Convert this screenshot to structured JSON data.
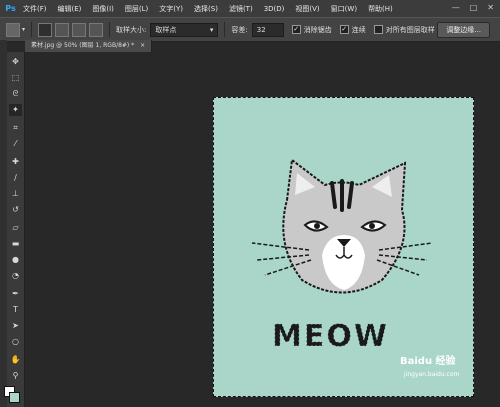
{
  "menubar": {
    "logo": "Ps",
    "items": [
      "文件(F)",
      "编辑(E)",
      "图像(I)",
      "图层(L)",
      "文字(Y)",
      "选择(S)",
      "滤镜(T)",
      "3D(D)",
      "视图(V)",
      "窗口(W)",
      "帮助(H)"
    ],
    "controls": [
      "—",
      "□",
      "✕"
    ]
  },
  "options": {
    "sample_size_label": "取样大小:",
    "sample_size_value": "取样点",
    "tolerance_label": "容差:",
    "tolerance_value": "32",
    "antialias_label": "消除锯齿",
    "contiguous_label": "连续",
    "all_layers_label": "对所有图层取样",
    "refine_edge": "调整边缘..."
  },
  "document": {
    "tab_title": "素材.jpg @ 50% (图层 1, RGB/8#) *",
    "tab_close": "×",
    "artwork_text": "MEOW"
  },
  "watermark": {
    "text": "Baidu 经验",
    "url": "jingyan.baidu.com"
  },
  "tools": [
    "move-icon",
    "marquee-icon",
    "lasso-icon",
    "magic-wand-icon",
    "crop-icon",
    "eyedropper-icon",
    "healing-icon",
    "brush-icon",
    "stamp-icon",
    "history-brush-icon",
    "eraser-icon",
    "gradient-icon",
    "blur-icon",
    "dodge-icon",
    "pen-icon",
    "type-icon",
    "path-select-icon",
    "shape-icon",
    "hand-icon",
    "zoom-icon"
  ],
  "colors": {
    "canvas_bg": "#a9d6c9",
    "workspace": "#282828"
  }
}
